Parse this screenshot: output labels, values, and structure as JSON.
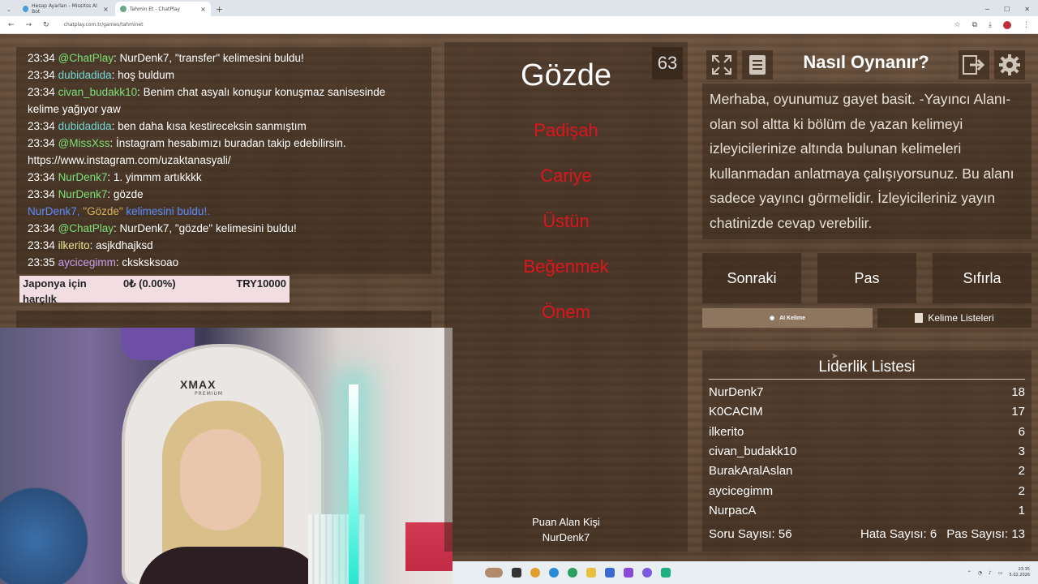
{
  "browser": {
    "tabs": [
      {
        "label": "Hesap Ayarları - MissXss AI Bot"
      },
      {
        "label": "Tahmin Et - ChatPlay"
      }
    ],
    "new_tab": "+",
    "url": "chatplay.com.tr/games/tahminet"
  },
  "chat": {
    "lines": [
      {
        "time": "23:34",
        "user": "@ChatPlay",
        "msg": ": NurDenk7, \"transfer\" kelimesini buldu!"
      },
      {
        "time": "23:34",
        "user": "dubidadida",
        "msg": ": hoş buldum"
      },
      {
        "time": "23:34",
        "user": "civan_budakk10",
        "msg": ": Benim chat asyalı konuşur konuşmaz sanisesinde kelime yağıyor yaw"
      },
      {
        "time": "23:34",
        "user": "dubidadida",
        "msg": ": ben daha kısa kestireceksin sanmıştım"
      },
      {
        "time": "23:34",
        "user": "@MissXss",
        "msg": ": İnstagram hesabımızı buradan takip edebilirsin. https://www.instagram.com/uzaktanasyali/"
      },
      {
        "time": "23:34",
        "user": "NurDenk7",
        "msg": ": 1. yimmm artıkkkk"
      },
      {
        "time": "23:34",
        "user": "NurDenk7",
        "msg": ": gözde"
      },
      {
        "time": "",
        "user": "NurDenk7, ",
        "found_word": "\"Gözde\"",
        "msg": " kelimesini buldu!."
      },
      {
        "time": "23:34",
        "user": "@ChatPlay",
        "msg": ": NurDenk7, \"gözde\" kelimesini buldu!"
      },
      {
        "time": "23:34",
        "user": "ilkerito",
        "msg": ": asjkdhajksd"
      },
      {
        "time": "23:35",
        "user": "aycicegimm",
        "msg": ": cksksksoao"
      }
    ]
  },
  "donation": {
    "name": "Japonya için harçlık",
    "amount": "0₺ (0.00%)",
    "goal": "TRY10000"
  },
  "webcam": {
    "chair_brand": "XMAX",
    "chair_sub": "PREMIUM"
  },
  "game": {
    "word": "Gözde",
    "timer": "63",
    "taboo_words": [
      "Padişah",
      "Cariye",
      "Üstün",
      "Beğenmek",
      "Önem"
    ],
    "scorer_label": "Puan Alan Kişi",
    "scorer_name": "NurDenk7"
  },
  "howto": {
    "title": "Nasıl Oynanır?",
    "text": "Merhaba, oyunumuz gayet basit. -Yayıncı Alanı- olan sol altta ki bölüm de yazan kelimeyi izleyicilerinize altında bulunan kelimeleri kullanmadan anlatmaya çalışıyorsunuz. Bu alanı sadece yayıncı görmelidir. İzleyicileriniz yayın chatinizde cevap verebilir."
  },
  "controls": {
    "next": "Sonraki",
    "pass": "Pas",
    "reset": "Sıfırla",
    "ai_tab": "AI Kelime",
    "lists_tab": "Kelime Listeleri"
  },
  "leaderboard": {
    "title": "Liderlik Listesi",
    "rows": [
      {
        "name": "NurDenk7",
        "score": "18"
      },
      {
        "name": "K0CACIM",
        "score": "17"
      },
      {
        "name": "ilkerito",
        "score": "6"
      },
      {
        "name": "civan_budakk10",
        "score": "3"
      },
      {
        "name": "BurakAralAslan",
        "score": "2"
      },
      {
        "name": "aycicegimm",
        "score": "2"
      },
      {
        "name": "NurpacA",
        "score": "1"
      }
    ],
    "questions": "Soru Sayısı: 56",
    "errors": "Hata Sayısı: 6",
    "passes": "Pas Sayısı: 13"
  },
  "taskbar": {
    "time": "23:35",
    "date": "5.02.2026"
  },
  "colors": {
    "accent_red": "#e0141e",
    "wood": "#5c4532"
  }
}
